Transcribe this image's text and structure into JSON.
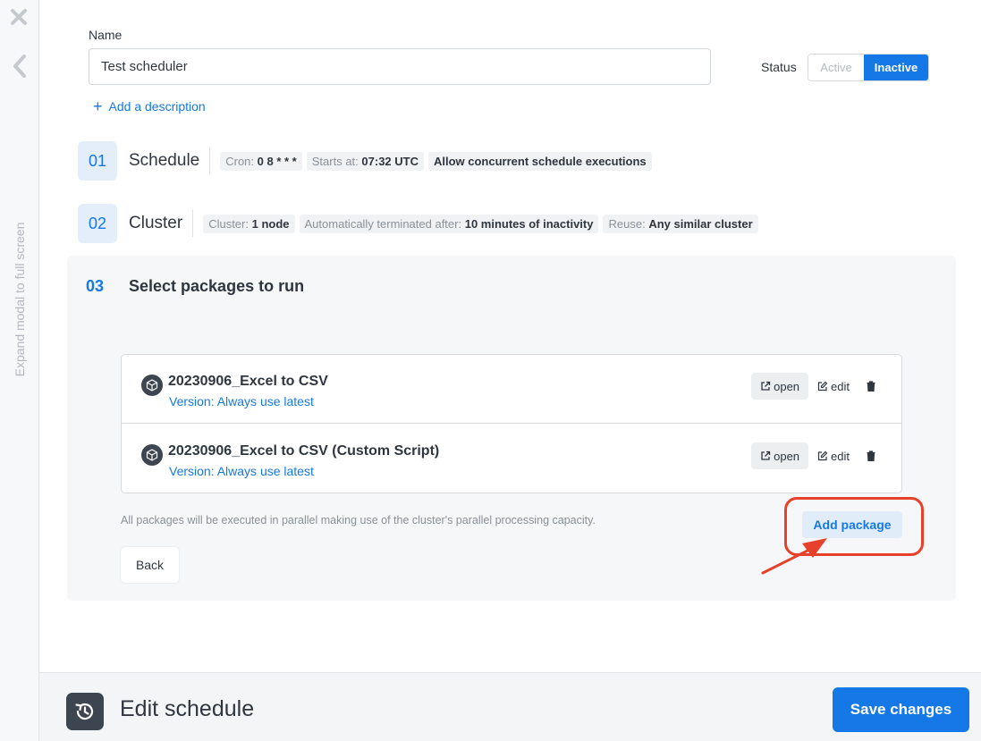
{
  "rail": {
    "expand_label": "Expand modal to full screen"
  },
  "form": {
    "name_label": "Name",
    "name_value": "Test scheduler",
    "status_label": "Status",
    "status_options": [
      "Active",
      "Inactive"
    ],
    "status_selected": "Inactive",
    "add_description": "Add a description"
  },
  "steps": [
    {
      "number": "01",
      "title": "Schedule",
      "chips": [
        {
          "label": "Cron:",
          "value": "0 8 * * *"
        },
        {
          "label": "Starts at:",
          "value": "07:32 UTC"
        },
        {
          "label": "",
          "value": "Allow concurrent schedule executions"
        }
      ]
    },
    {
      "number": "02",
      "title": "Cluster",
      "chips": [
        {
          "label": "Cluster:",
          "value": "1 node"
        },
        {
          "label": "Automatically terminated after:",
          "value": "10 minutes of inactivity"
        },
        {
          "label": "Reuse:",
          "value": "Any similar cluster"
        }
      ]
    }
  ],
  "packages_section": {
    "number": "03",
    "title": "Select packages to run",
    "packages": [
      {
        "name": "20230906_Excel to CSV",
        "version": "Version: Always use latest"
      },
      {
        "name": "20230906_Excel to CSV (Custom Script)",
        "version": "Version: Always use latest"
      }
    ],
    "open_label": "open",
    "edit_label": "edit",
    "hint": "All packages will be executed in parallel making use of the cluster's parallel processing capacity.",
    "add_package_label": "Add package",
    "back_label": "Back"
  },
  "footer": {
    "title": "Edit schedule",
    "save_label": "Save changes"
  },
  "colors": {
    "accent": "#1479e6",
    "annotation": "#e8412b"
  }
}
